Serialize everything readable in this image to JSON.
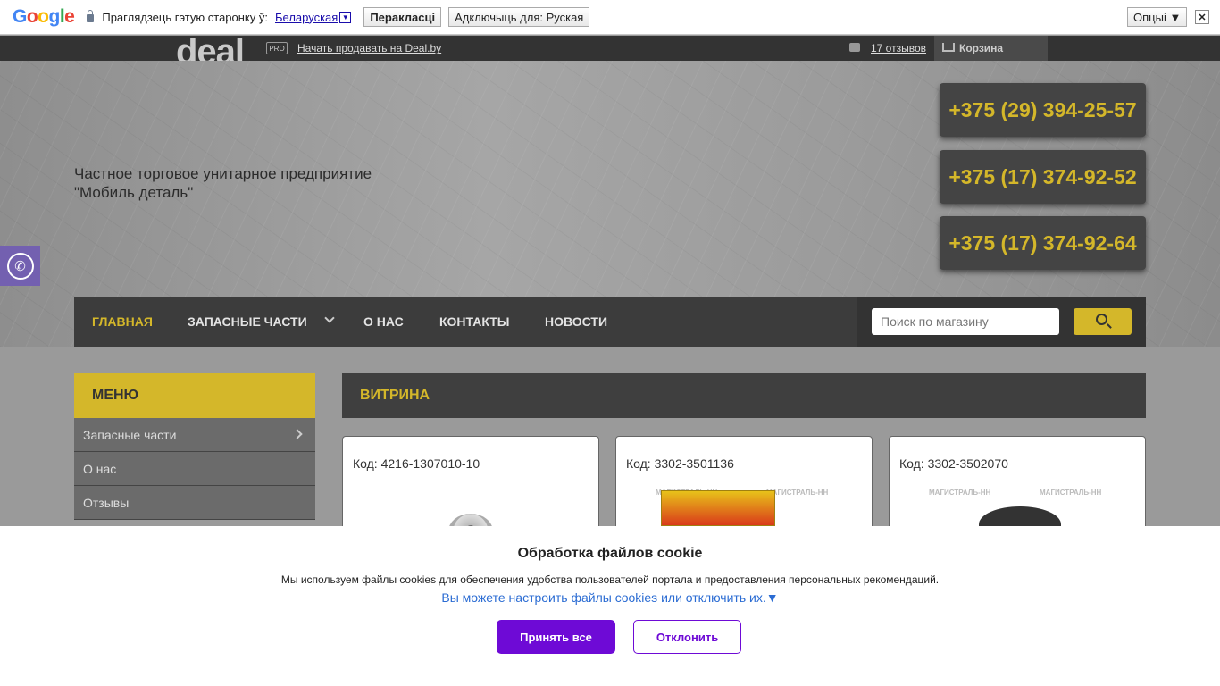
{
  "translate_bar": {
    "logo_letters": [
      "G",
      "o",
      "o",
      "g",
      "l",
      "e"
    ],
    "prompt": "Праглядзець гэтую старонку ў:",
    "language": "Беларуская",
    "lang_arrow": "▼",
    "translate_button": "Перакласці",
    "disable_button": "Адключыць для: Руская",
    "options_button": "Опцыі ▼",
    "close": "✕"
  },
  "topbar": {
    "logo": "deal",
    "pro_badge": "PRO",
    "sell_link": "Начать продавать на Deal.by",
    "reviews_link": "17 отзывов",
    "cart_label": "Корзина"
  },
  "header": {
    "company_line1": "Частное торговое унитарное предприятие",
    "company_line2": "\"Мобиль деталь\"",
    "phones": [
      "+375 (29) 394-25-57",
      "+375 (17) 374-92-52",
      "+375 (17) 374-92-64"
    ]
  },
  "nav": {
    "items": [
      "Главная",
      "Запасные части",
      "О нас",
      "Контакты",
      "Новости"
    ],
    "search_placeholder": "Поиск по магазину"
  },
  "sidebar": {
    "title": "МЕНЮ",
    "items": [
      "Запасные части",
      "О нас",
      "Отзывы"
    ]
  },
  "showcase": {
    "title": "ВИТРИНА",
    "cards": [
      {
        "code": "Код: 4216-1307010-10"
      },
      {
        "code": "Код: 3302-3501136",
        "watermark": "МАГИСТРАЛЬ-НН"
      },
      {
        "code": "Код: 3302-3502070",
        "watermark": "МАГИСТРАЛЬ-НН"
      }
    ]
  },
  "cookie": {
    "title": "Обработка файлов cookie",
    "text": "Мы используем файлы cookies для обеспечения удобства пользователей портала и предоставления персональных рекомендаций.",
    "link": "Вы можете настроить файлы cookies или отключить их.▼",
    "accept": "Принять все",
    "decline": "Отклонить"
  },
  "colors": {
    "accent": "#d4b72a",
    "cookie_accent": "#6e0ad6",
    "viber": "#7360b0"
  }
}
